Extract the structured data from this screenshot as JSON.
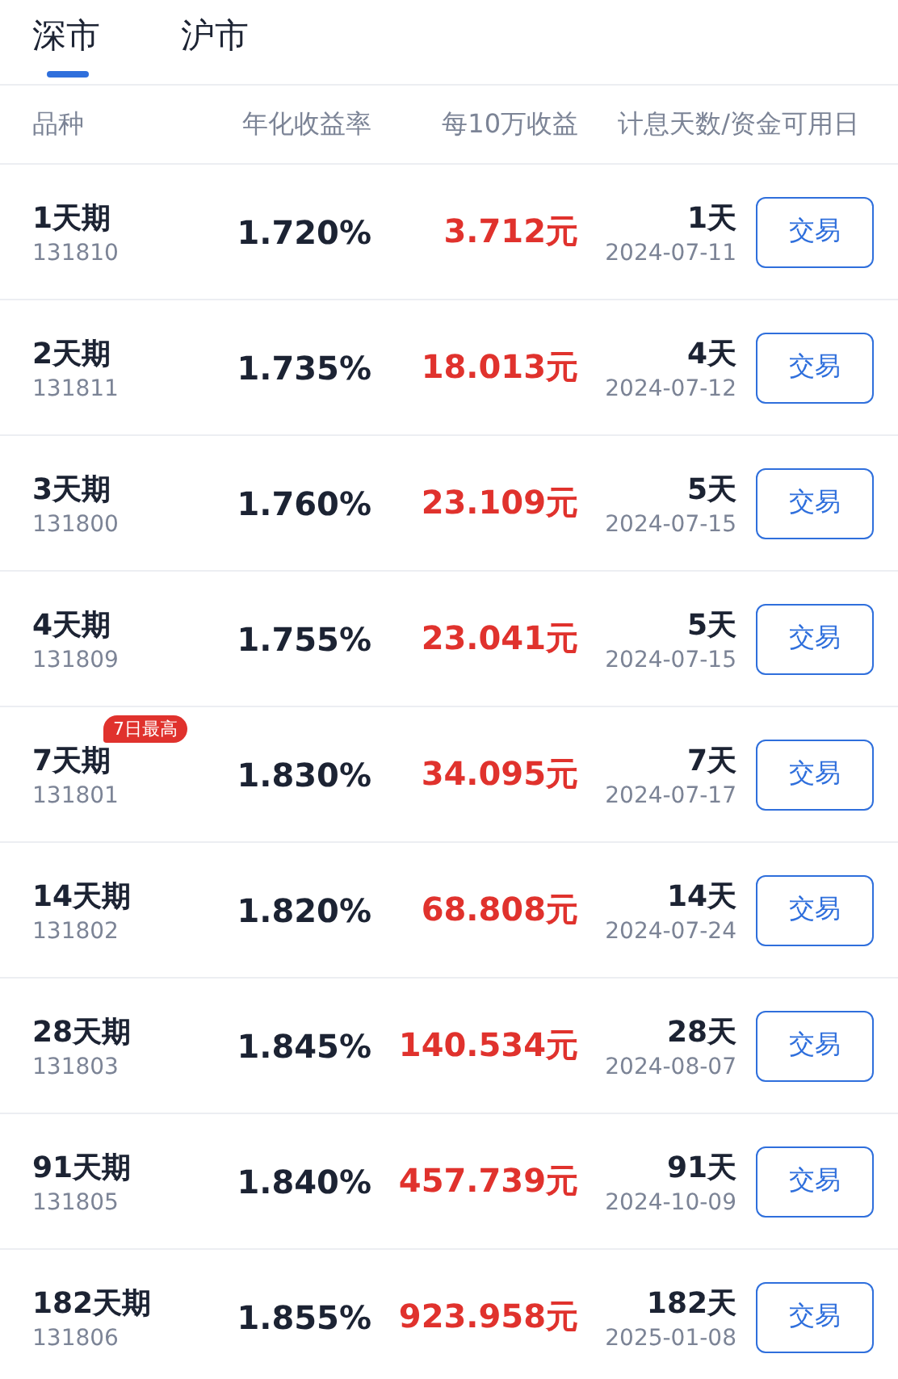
{
  "tabs": [
    {
      "label": "深市",
      "selected": true
    },
    {
      "label": "沪市",
      "selected": false
    }
  ],
  "columns": [
    "品种",
    "年化收益率",
    "每10万收益",
    "计息天数/资金可用日"
  ],
  "rows": [
    {
      "name": "1天期",
      "code": "131810",
      "rate": "1.720%",
      "income": "3.712元",
      "days": "1天",
      "date": "2024-07-11",
      "action": "交易"
    },
    {
      "name": "2天期",
      "code": "131811",
      "rate": "1.735%",
      "income": "18.013元",
      "days": "4天",
      "date": "2024-07-12",
      "action": "交易"
    },
    {
      "name": "3天期",
      "code": "131800",
      "rate": "1.760%",
      "income": "23.109元",
      "days": "5天",
      "date": "2024-07-15",
      "action": "交易"
    },
    {
      "name": "4天期",
      "code": "131809",
      "rate": "1.755%",
      "income": "23.041元",
      "days": "5天",
      "date": "2024-07-15",
      "action": "交易"
    },
    {
      "name": "7天期",
      "code": "131801",
      "badge": "7日最高",
      "rate": "1.830%",
      "income": "34.095元",
      "days": "7天",
      "date": "2024-07-17",
      "action": "交易"
    },
    {
      "name": "14天期",
      "code": "131802",
      "rate": "1.820%",
      "income": "68.808元",
      "days": "14天",
      "date": "2024-07-24",
      "action": "交易"
    },
    {
      "name": "28天期",
      "code": "131803",
      "rate": "1.845%",
      "income": "140.534元",
      "days": "28天",
      "date": "2024-08-07",
      "action": "交易"
    },
    {
      "name": "91天期",
      "code": "131805",
      "rate": "1.840%",
      "income": "457.739元",
      "days": "91天",
      "date": "2024-10-09",
      "action": "交易"
    },
    {
      "name": "182天期",
      "code": "131806",
      "rate": "1.855%",
      "income": "923.958元",
      "days": "182天",
      "date": "2025-01-08",
      "action": "交易"
    }
  ]
}
